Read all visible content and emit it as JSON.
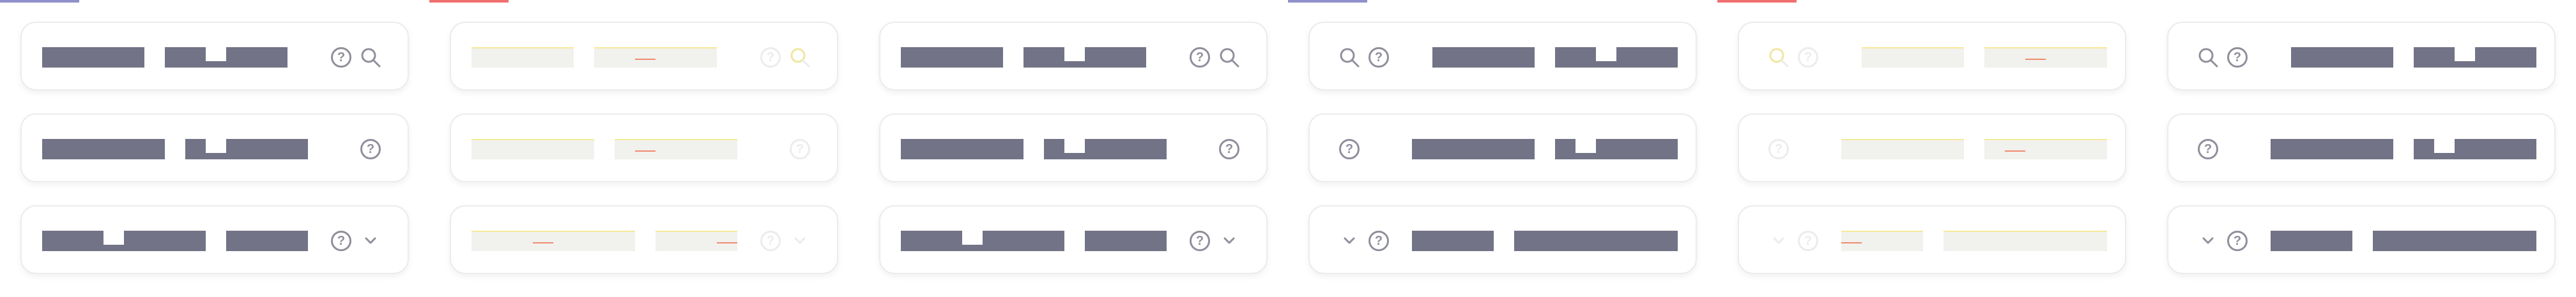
{
  "colors": {
    "bar": "#727386",
    "icon": "#8f8f9c",
    "tab_enabled": "#8f90c9",
    "tab_disabled": "#f07070",
    "disabled_bar": "#f1f1ee"
  },
  "icons": {
    "help": "?",
    "search": "search-icon",
    "chevron": "chevron-down-icon"
  },
  "columns": [
    {
      "state": "enabled",
      "layout": "ltr"
    },
    {
      "state": "disabled",
      "layout": "ltr"
    },
    {
      "state": "enabled",
      "layout": "ltr"
    },
    {
      "state": "enabled",
      "layout": "rtl"
    },
    {
      "state": "disabled",
      "layout": "rtl"
    },
    {
      "state": "enabled",
      "layout": "rtl"
    }
  ]
}
